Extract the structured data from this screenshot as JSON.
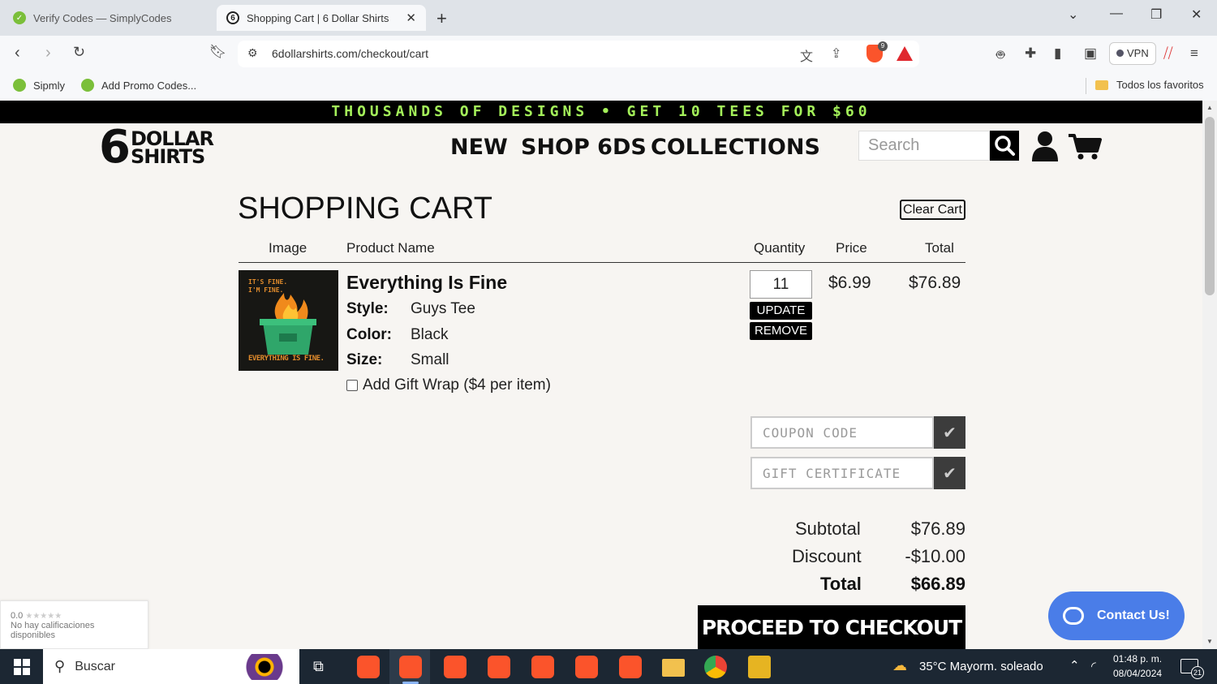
{
  "browser": {
    "tabs": [
      {
        "title": "Verify Codes — SimplyCodes",
        "active": false
      },
      {
        "title": "Shopping Cart | 6 Dollar Shirts",
        "active": true
      }
    ],
    "url": "6dollarshirts.com/checkout/cart",
    "vpn_label": "VPN",
    "shield_count": "9",
    "bookmarks": [
      "Sipmly",
      "Add Promo Codes..."
    ],
    "bookmarks_folder": "Todos los favoritos"
  },
  "site": {
    "promo_banner": "THOUSANDS OF DESIGNS • GET 10 TEES FOR $60",
    "logo_number": "6",
    "logo_line1": "DOLLAR",
    "logo_line2": "SHIRTS",
    "nav": [
      "NEW",
      "SHOP 6DS",
      "COLLECTIONS"
    ],
    "search_placeholder": "Search"
  },
  "cart": {
    "title": "SHOPPING CART",
    "clear_label": "Clear Cart",
    "headers": {
      "image": "Image",
      "product": "Product Name",
      "quantity": "Quantity",
      "price": "Price",
      "total": "Total"
    },
    "item": {
      "name": "Everything Is Fine",
      "image_text_top": "IT'S FINE. I'M FINE.",
      "image_text_bottom": "EVERYTHING IS FINE.",
      "attributes": [
        {
          "label": "Style:",
          "value": "Guys Tee"
        },
        {
          "label": "Color:",
          "value": "Black"
        },
        {
          "label": "Size:",
          "value": "Small"
        }
      ],
      "gift_wrap_label": "Add Gift Wrap ($4 per item)",
      "quantity": "11",
      "update_label": "UPDATE",
      "remove_label": "REMOVE",
      "price": "$6.99",
      "total": "$76.89"
    },
    "coupon_placeholder": "COUPON CODE",
    "gift_placeholder": "GIFT CERTIFICATE",
    "summary": {
      "subtotal_label": "Subtotal",
      "subtotal": "$76.89",
      "discount_label": "Discount",
      "discount": "-$10.00",
      "total_label": "Total",
      "total": "$66.89"
    },
    "checkout_label": "PROCEED TO CHECKOUT"
  },
  "widgets": {
    "rating_score": "0.0",
    "rating_text": "No hay calificaciones disponibles",
    "contact_label": "Contact Us!"
  },
  "taskbar": {
    "search_label": "Buscar",
    "weather": "35°C  Mayorm. soleado",
    "time": "01:48 p. m.",
    "date": "08/04/2024",
    "notifications": "21"
  },
  "colors": {
    "promo_text": "#a4f15a",
    "page_bg": "#f7f5f2",
    "contact_bg": "#4a7de8",
    "brave_orange": "#fb542b",
    "taskbar_bg": "#1c2733"
  }
}
